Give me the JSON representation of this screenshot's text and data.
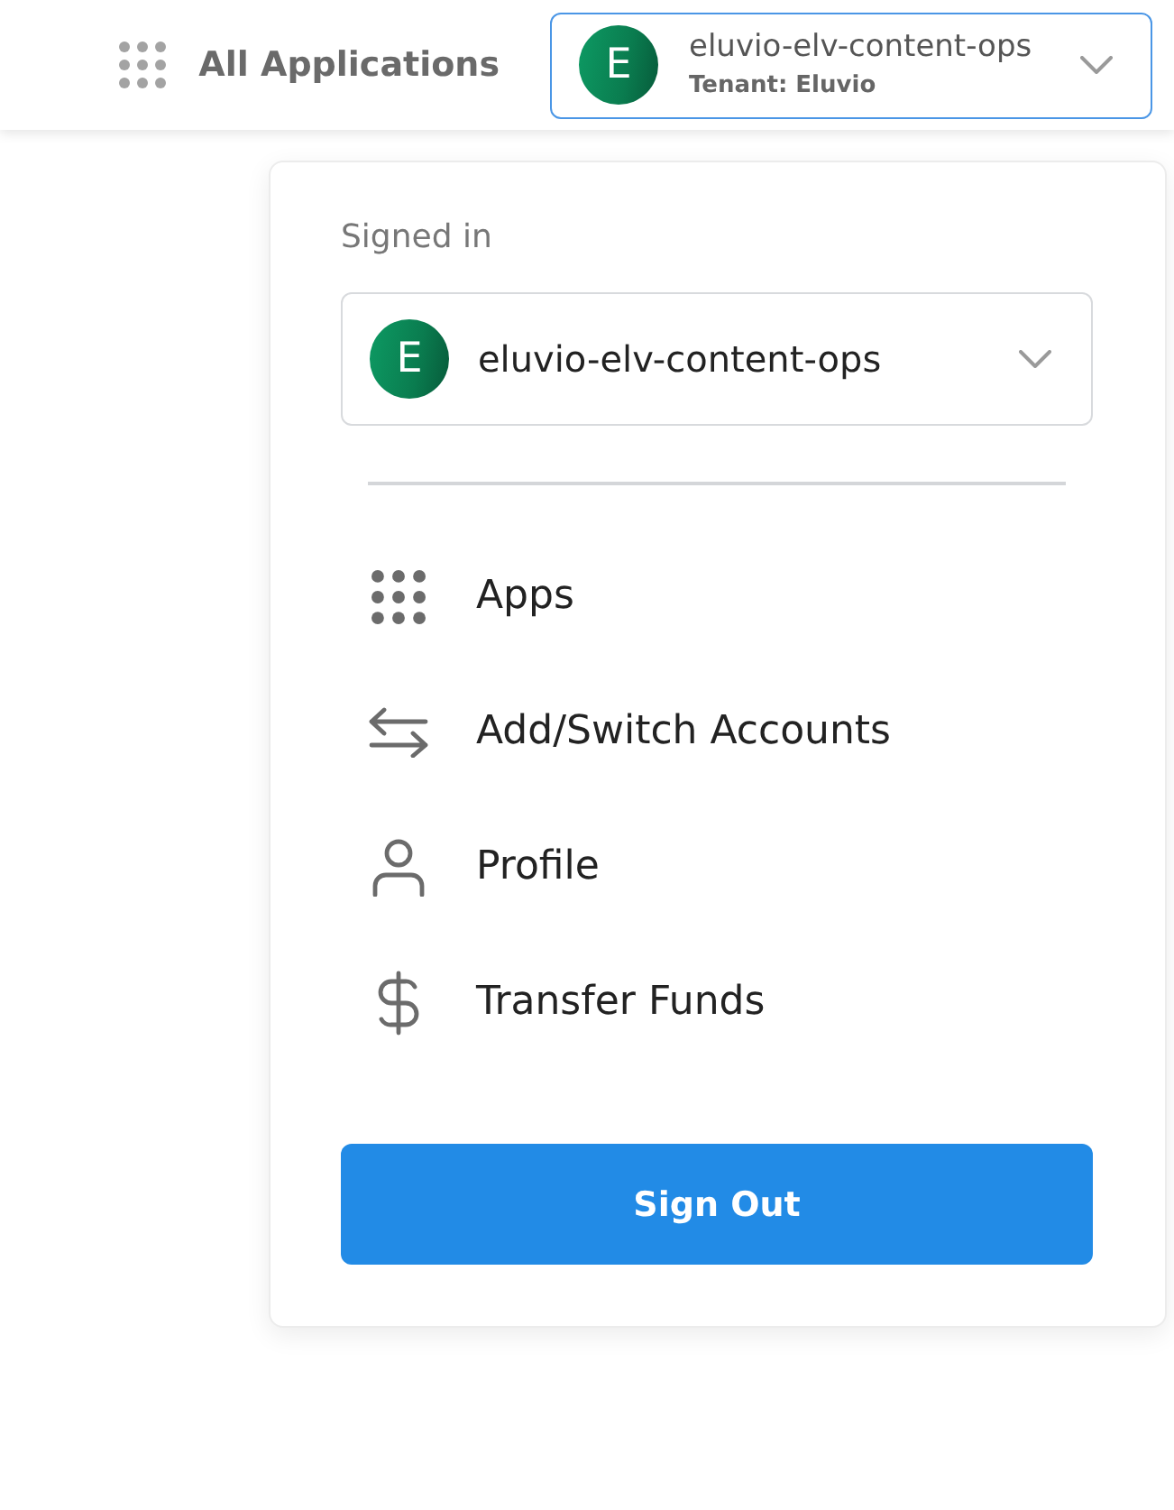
{
  "header": {
    "apps_link": {
      "label": "All Applications"
    },
    "account": {
      "avatar": "E",
      "name": "eluvio-elv-content-ops",
      "tenant": "Tenant: Eluvio"
    }
  },
  "menu": {
    "heading": "Signed in",
    "account_select": {
      "avatar": "E",
      "name": "eluvio-elv-content-ops"
    },
    "items": [
      {
        "kind": "apps",
        "label": "Apps"
      },
      {
        "kind": "switch",
        "label": "Add/Switch Accounts"
      },
      {
        "kind": "profile",
        "label": "Profile"
      },
      {
        "kind": "funds",
        "label": "Transfer Funds"
      }
    ],
    "sign_out": "Sign Out"
  }
}
